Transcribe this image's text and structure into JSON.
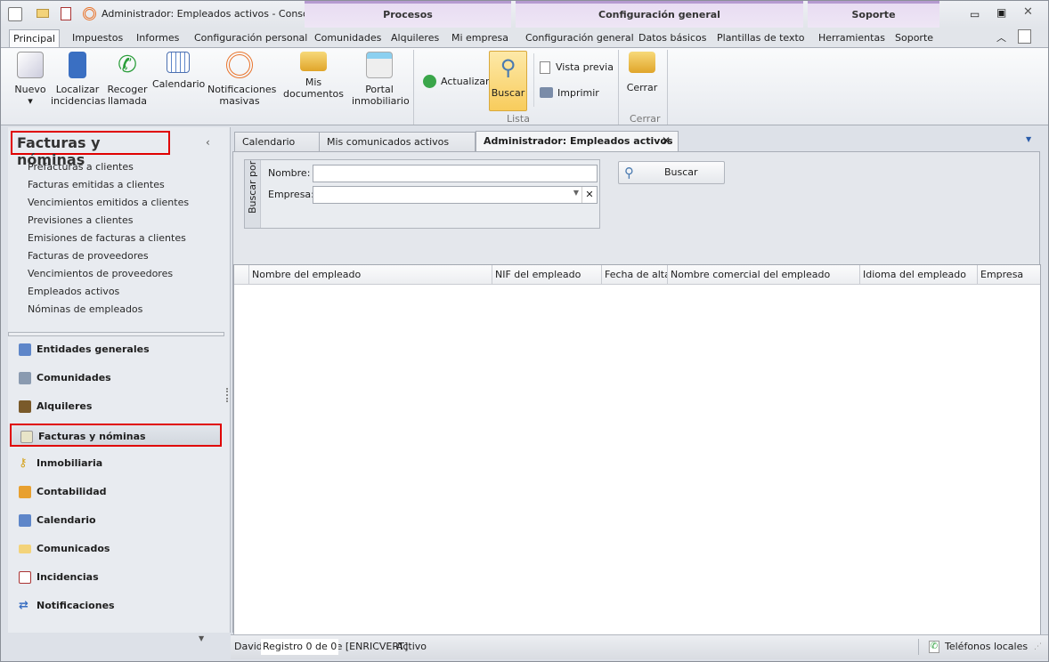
{
  "window": {
    "title": "Administrador: Empleados activos - Consola ...",
    "contextual_groups": [
      "Procesos",
      "Configuración general",
      "Soporte"
    ]
  },
  "ribbon_tabs": [
    "Principal",
    "Impuestos",
    "Informes",
    "Configuración personal",
    "Comunidades",
    "Alquileres",
    "Mi empresa",
    "Configuración general",
    "Datos básicos",
    "Plantillas de texto",
    "Herramientas",
    "Soporte"
  ],
  "ribbon": {
    "nuevo": "Nuevo",
    "localizar": "Localizar incidencias",
    "recoger": "Recoger llamada",
    "calendario": "Calendario",
    "notificaciones": "Notificaciones masivas",
    "documentos": "Mis documentos",
    "portal": "Portal inmobiliario",
    "actualizar": "Actualizar",
    "buscar": "Buscar",
    "vista_previa": "Vista previa",
    "imprimir": "Imprimir",
    "cerrar": "Cerrar",
    "group_lista": "Lista",
    "group_cerrar": "Cerrar"
  },
  "sidebar": {
    "title": "Facturas y nóminas",
    "items": [
      "Prefacturas a clientes",
      "Facturas emitidas a clientes",
      "Vencimientos emitidos a clientes",
      "Previsiones a clientes",
      "Emisiones de facturas a clientes",
      "Facturas de proveedores",
      "Vencimientos de proveedores",
      "Empleados activos",
      "Nóminas de empleados"
    ],
    "nav": [
      "Entidades generales",
      "Comunidades",
      "Alquileres",
      "Facturas y nóminas",
      "Inmobiliaria",
      "Contabilidad",
      "Calendario",
      "Comunicados",
      "Incidencias",
      "Notificaciones"
    ]
  },
  "doc_tabs": [
    "Calendario",
    "Mis comunicados activos",
    "Administrador: Empleados activos"
  ],
  "search": {
    "group_label": "Buscar por",
    "nombre_label": "Nombre:",
    "nombre_value": "",
    "empresa_label": "Empresa:",
    "empresa_value": "",
    "button": "Buscar"
  },
  "grid": {
    "columns": [
      "Nombre del empleado",
      "NIF del empleado",
      "Fecha de alta",
      "Nombre comercial del empleado",
      "Idioma del empleado",
      "Empresa"
    ],
    "rows": [],
    "record_text": "Registro 0 de 0"
  },
  "status": {
    "user": "David Quintas Alcalde [ENRICVERT]",
    "state": "Activo",
    "phones": "Teléfonos locales"
  },
  "colors": {
    "highlight_box": "#e00000",
    "buscar_active": "#fbd97a"
  }
}
